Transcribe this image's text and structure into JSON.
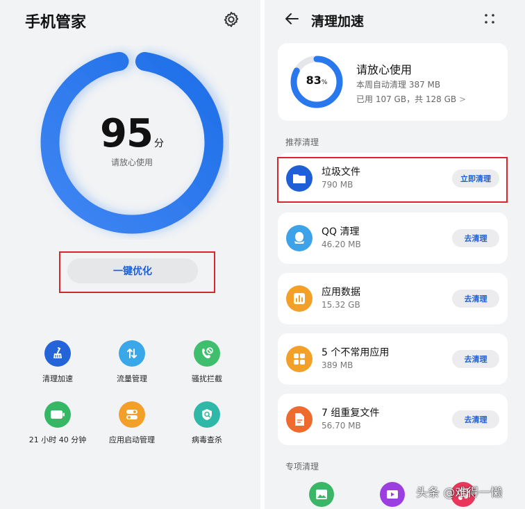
{
  "left": {
    "title": "手机管家",
    "score": "95",
    "score_unit": "分",
    "score_sub": "请放心使用",
    "score_value": 95,
    "optimize_label": "一键优化",
    "tools": [
      {
        "label": "清理加速",
        "icon": "broom-icon",
        "color": "#2563d9"
      },
      {
        "label": "流量管理",
        "icon": "data-transfer-icon",
        "color": "#3aa7e8"
      },
      {
        "label": "骚扰拦截",
        "icon": "phone-block-icon",
        "color": "#3fbf6d"
      },
      {
        "label": "21 小时 40 分钟",
        "icon": "battery-icon",
        "color": "#36b766"
      },
      {
        "label": "应用启动管理",
        "icon": "toggle-icon",
        "color": "#f3a02b"
      },
      {
        "label": "病毒查杀",
        "icon": "shield-scan-icon",
        "color": "#2fb8a8"
      }
    ]
  },
  "right": {
    "title": "清理加速",
    "status": {
      "percent": "83",
      "percent_sign": "%",
      "percent_value": 83,
      "title": "请放心使用",
      "line1": "本周自动清理 387 MB",
      "line2": "已用 107 GB，共 128 GB",
      "chevron": ">"
    },
    "recommended_label": "推荐清理",
    "items": [
      {
        "title": "垃圾文件",
        "size": "790 MB",
        "button": "立即清理",
        "icon": "folder-icon",
        "color": "#1f5fd6"
      },
      {
        "title": "QQ 清理",
        "size": "46.20 MB",
        "button": "去清理",
        "icon": "qq-icon",
        "color": "#3ea2e8"
      },
      {
        "title": "应用数据",
        "size": "15.32 GB",
        "button": "去清理",
        "icon": "chart-icon",
        "color": "#f3a02b"
      },
      {
        "title": "5 个不常用应用",
        "size": "389 MB",
        "button": "去清理",
        "icon": "apps-grid-icon",
        "color": "#f3a02b"
      },
      {
        "title": "7 组重复文件",
        "size": "56.70 MB",
        "button": "去清理",
        "icon": "duplicate-file-icon",
        "color": "#ef6a2e"
      }
    ],
    "special_label": "专项清理",
    "bottom_icons": [
      {
        "icon": "gallery-icon",
        "color": "#39b766"
      },
      {
        "icon": "video-icon",
        "color": "#9b3fe0"
      },
      {
        "icon": "music-icon",
        "color": "#e8375b"
      }
    ]
  },
  "watermark": "头条 @难得一懒",
  "accent": "#1f5fd6",
  "highlight_border": "#d7262e"
}
